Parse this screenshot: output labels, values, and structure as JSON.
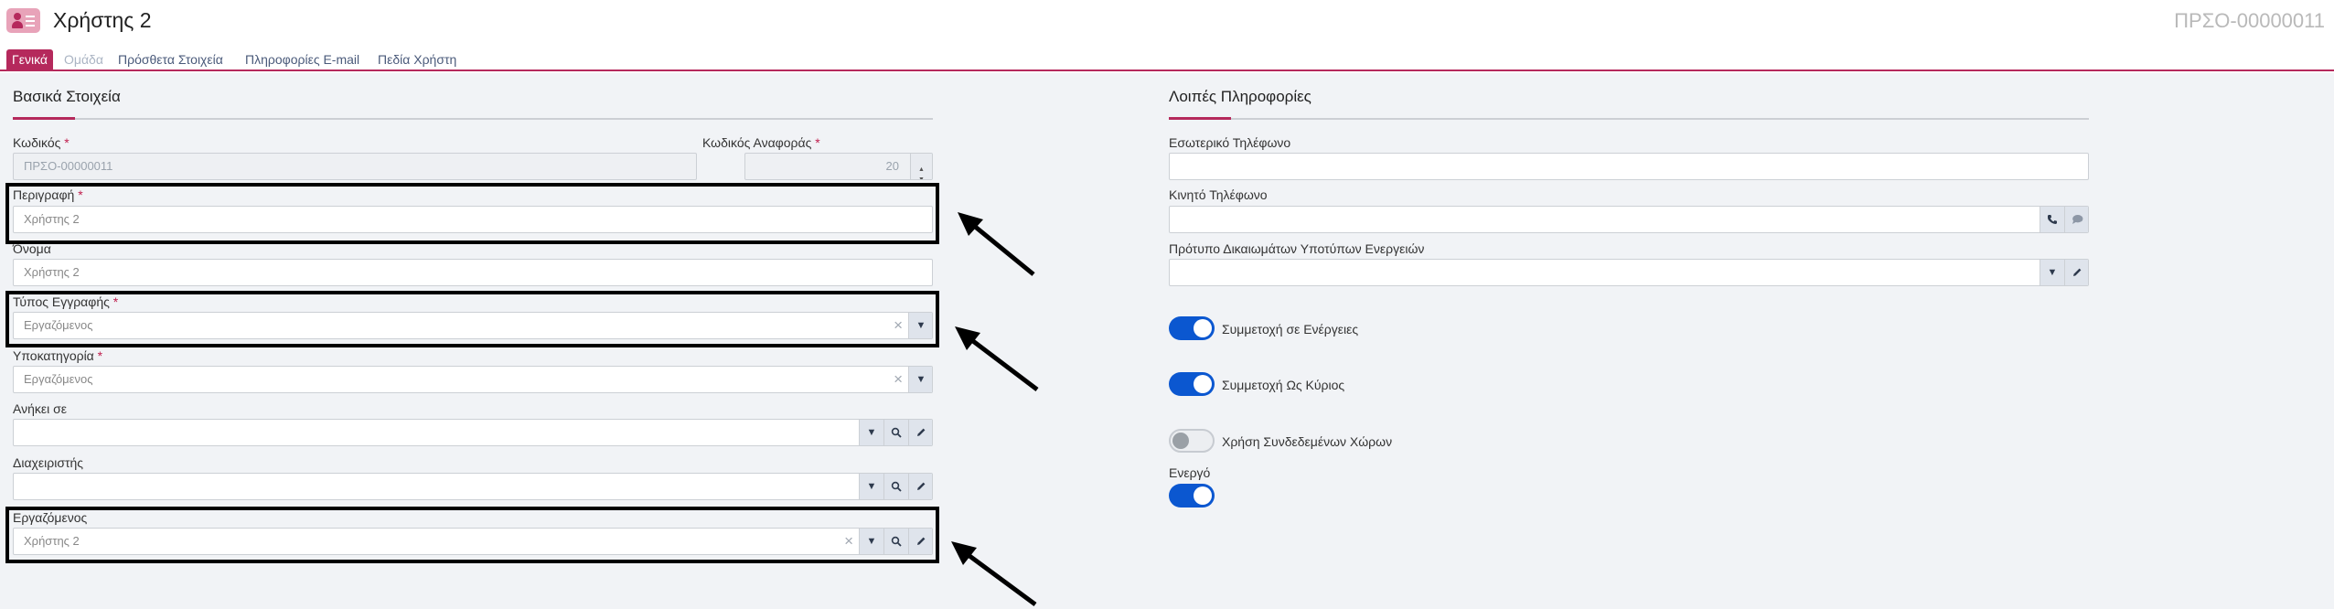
{
  "header": {
    "title": "Χρήστης 2",
    "record_code": "ΠΡΣΟ-00000011",
    "app_icon": "user-list-icon"
  },
  "tabs": [
    {
      "label": "Γενικά",
      "active": true
    },
    {
      "label": "Ομάδα",
      "disabled": true
    },
    {
      "label": "Πρόσθετα Στοιχεία"
    },
    {
      "label": "Πληροφορίες E-mail"
    },
    {
      "label": "Πεδία Χρήστη"
    }
  ],
  "left": {
    "section_title": "Βασικά Στοιχεία",
    "code": {
      "label": "Κωδικός",
      "value": "ΠΡΣΟ-00000011"
    },
    "ref_code": {
      "label": "Κωδικός Αναφοράς",
      "value": "20"
    },
    "description": {
      "label": "Περιγραφή",
      "value": "Χρήστης 2"
    },
    "name": {
      "label": "Όνομα",
      "value": "Χρήστης 2"
    },
    "record_type": {
      "label": "Τύπος Εγγραφής",
      "value": "Εργαζόμενος"
    },
    "subcategory": {
      "label": "Υποκατηγορία",
      "value": "Εργαζόμενος"
    },
    "belongs_to": {
      "label": "Ανήκει σε",
      "value": ""
    },
    "manager": {
      "label": "Διαχειριστής",
      "value": ""
    },
    "employee": {
      "label": "Εργαζόμενος",
      "value": "Χρήστης 2"
    },
    "required_mark": "*"
  },
  "right": {
    "section_title": "Λοιπές Πληροφορίες",
    "internal_phone": {
      "label": "Εσωτερικό Τηλέφωνο",
      "value": ""
    },
    "mobile_phone": {
      "label": "Κινητό Τηλέφωνο",
      "value": ""
    },
    "permissions_template": {
      "label": "Πρότυπο Δικαιωμάτων Υποτύπων Ενεργειών",
      "value": ""
    },
    "toggles": [
      {
        "label": "Συμμετοχή σε Ενέργειες",
        "on": true
      },
      {
        "label": "Συμμετοχή Ως Κύριος",
        "on": true
      },
      {
        "label": "Χρήση Συνδεδεμένων Χώρων",
        "on": false
      }
    ],
    "active": {
      "label": "Ενεργό",
      "on": true
    }
  },
  "colors": {
    "accent": "#b5295c",
    "toggle_on": "#0b57d0",
    "background": "#f1f3f6"
  }
}
